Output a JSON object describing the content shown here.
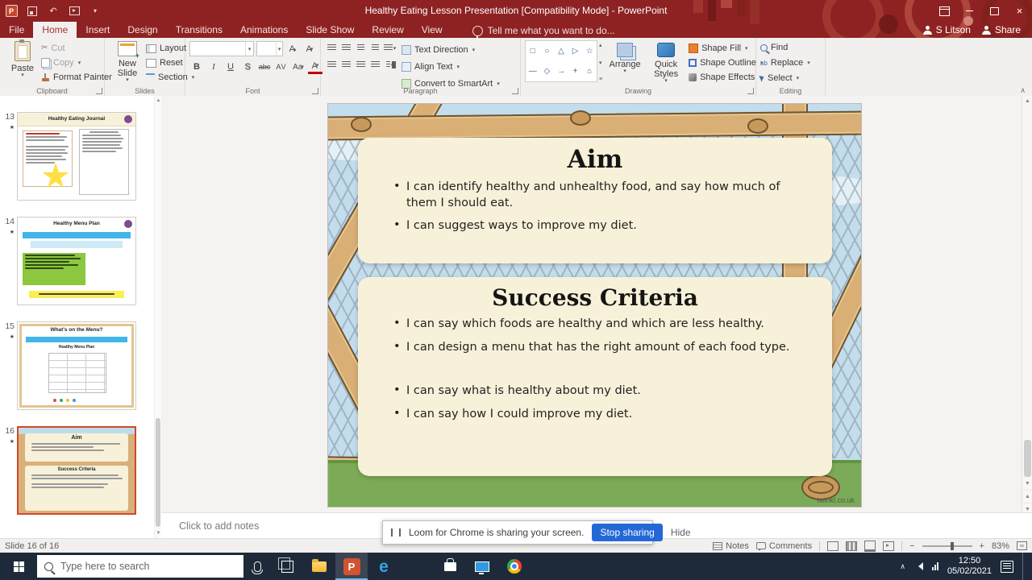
{
  "window": {
    "title": "Healthy Eating Lesson Presentation [Compatibility Mode] - PowerPoint",
    "account_name": "S Litson",
    "share_label": "Share"
  },
  "tabs": {
    "items": [
      {
        "label": "File"
      },
      {
        "label": "Home"
      },
      {
        "label": "Insert"
      },
      {
        "label": "Design"
      },
      {
        "label": "Transitions"
      },
      {
        "label": "Animations"
      },
      {
        "label": "Slide Show"
      },
      {
        "label": "Review"
      },
      {
        "label": "View"
      }
    ],
    "tell_me": "Tell me what you want to do..."
  },
  "ribbon": {
    "clipboard": {
      "label": "Clipboard",
      "paste": "Paste",
      "cut": "Cut",
      "copy": "Copy",
      "format_painter": "Format Painter"
    },
    "slides": {
      "label": "Slides",
      "new_slide": "New Slide",
      "layout": "Layout",
      "reset": "Reset",
      "section": "Section"
    },
    "font": {
      "label": "Font",
      "name_value": "",
      "size_value": "",
      "bold": "B",
      "italic": "I",
      "underline": "U",
      "shadow": "S",
      "strikethrough": "abc",
      "char_spacing": "AV",
      "change_case": "Aa",
      "font_color": "A",
      "grow_font": "A",
      "shrink_font": "A"
    },
    "paragraph": {
      "label": "Paragraph",
      "text_direction": "Text Direction",
      "align_text": "Align Text",
      "smartart": "Convert to SmartArt"
    },
    "drawing": {
      "label": "Drawing",
      "arrange": "Arrange",
      "quick_styles": "Quick Styles",
      "shape_fill": "Shape Fill",
      "shape_outline": "Shape Outline",
      "shape_effects": "Shape Effects"
    },
    "editing": {
      "label": "Editing",
      "find": "Find",
      "replace": "Replace",
      "select": "Select"
    }
  },
  "thumbnails": {
    "slides": [
      {
        "number": "13",
        "title": "Healthy Eating Journal"
      },
      {
        "number": "14",
        "title": "Healthy Menu Plan"
      },
      {
        "number": "15",
        "title": "What's on the Menu?",
        "subtitle": "Healthy Menu Plan"
      },
      {
        "number": "16"
      }
    ]
  },
  "slide": {
    "aim": {
      "title": "Aim",
      "bullets": [
        "I can identify healthy and unhealthy food, and say how much of them I should eat.",
        "I can suggest ways to improve my diet."
      ]
    },
    "success": {
      "title": "Success Criteria",
      "bullets": [
        "I can say which foods are healthy and which are less healthy.",
        "I can design a menu that has the right amount of each food type.",
        "I can say what is healthy about my diet.",
        "I can say how I could improve my diet."
      ]
    },
    "watermark": "twinkl.co.uk"
  },
  "notes_pane": {
    "placeholder": "Click to add notes"
  },
  "share_banner": {
    "message": "Loom for Chrome is sharing your screen.",
    "stop_button": "Stop sharing",
    "hide_button": "Hide"
  },
  "status_bar": {
    "slide_info": "Slide 16 of 16",
    "notes_label": "Notes",
    "comments_label": "Comments",
    "zoom_level": "83%"
  },
  "taskbar": {
    "search_placeholder": "Type here to search",
    "clock_time": "12:50",
    "clock_date": "05/02/2021"
  },
  "colors": {
    "titlebar_red": "#8e2223",
    "active_tab_text": "#a8352a",
    "selected_thumb_border": "#d0492a",
    "stop_button_blue": "#2468d8",
    "card_cream": "#f8f1d9",
    "slide_wood": "#d9af76"
  }
}
